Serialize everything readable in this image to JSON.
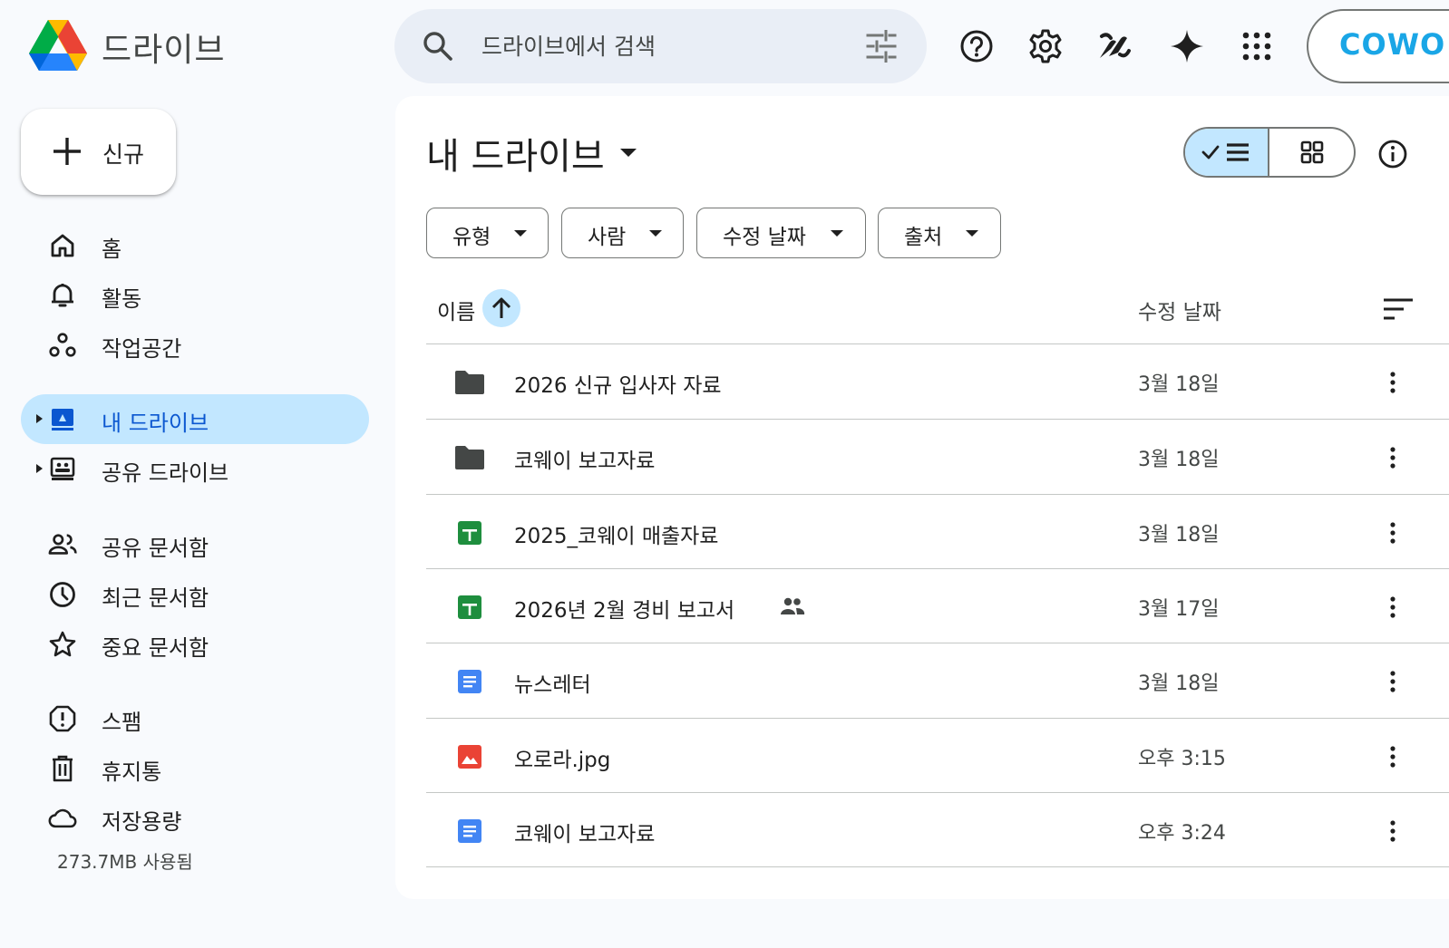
{
  "header": {
    "app_title": "드라이브",
    "search": {
      "placeholder": "드라이브에서 검색"
    },
    "icons": [
      "help-icon",
      "settings-icon",
      "gemini-brand-icon",
      "sparkle-icon",
      "apps-grid-icon"
    ],
    "account_text": "COWO"
  },
  "sidebar": {
    "new_button_label": "신규",
    "items": [
      {
        "label": "홈",
        "icon": "home-icon"
      },
      {
        "label": "활동",
        "icon": "bell-icon"
      },
      {
        "label": "작업공간",
        "icon": "workspaces-icon"
      },
      {
        "label": "내 드라이브",
        "icon": "my-drive-icon",
        "active": true
      },
      {
        "label": "공유 드라이브",
        "icon": "shared-drive-icon"
      },
      {
        "label": "공유 문서함",
        "icon": "people-icon"
      },
      {
        "label": "최근 문서함",
        "icon": "clock-icon"
      },
      {
        "label": "중요 문서함",
        "icon": "star-icon"
      },
      {
        "label": "스팸",
        "icon": "spam-icon"
      },
      {
        "label": "휴지통",
        "icon": "trash-icon"
      },
      {
        "label": "저장용량",
        "icon": "cloud-icon"
      }
    ],
    "storage_used": "273.7MB 사용됨"
  },
  "main": {
    "title": "내 드라이브",
    "filters": [
      "유형",
      "사람",
      "수정 날짜",
      "출처"
    ],
    "columns": {
      "name": "이름",
      "modified": "수정 날짜"
    },
    "files": [
      {
        "name": "2026 신규 입사자 자료",
        "type": "folder",
        "modified": "3월 18일",
        "shared": false
      },
      {
        "name": "코웨이 보고자료",
        "type": "folder",
        "modified": "3월 18일",
        "shared": false
      },
      {
        "name": "2025_코웨이 매출자료",
        "type": "sheet",
        "modified": "3월 18일",
        "shared": false
      },
      {
        "name": "2026년 2월 경비 보고서",
        "type": "sheet",
        "modified": "3월 17일",
        "shared": true
      },
      {
        "name": "뉴스레터",
        "type": "doc",
        "modified": "3월 18일",
        "shared": false
      },
      {
        "name": "오로라.jpg",
        "type": "image",
        "modified": "오후 3:15",
        "shared": false
      },
      {
        "name": "코웨이 보고자료",
        "type": "doc",
        "modified": "오후 3:24",
        "shared": false
      }
    ]
  },
  "colors": {
    "background": "#f8fafd",
    "active_nav": "#c2e7ff",
    "sheet_green": "#1e8e3e",
    "doc_blue": "#4285f4",
    "image_red": "#ea4335",
    "folder_gray": "#444746"
  }
}
